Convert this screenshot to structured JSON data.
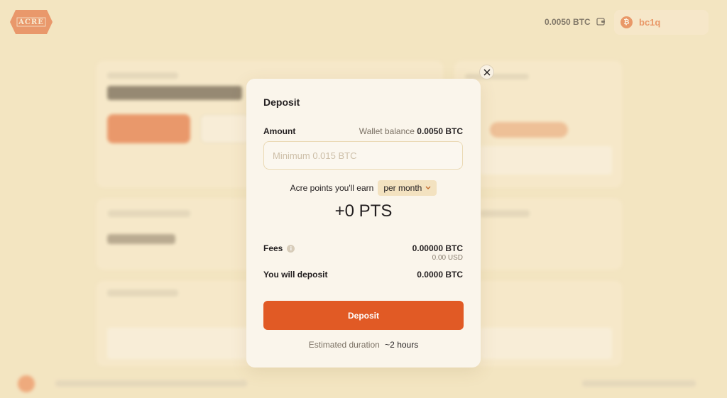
{
  "header": {
    "logo_text": "ACRE",
    "balance": "0.0050 BTC",
    "wallet_icon": "wallet-icon",
    "account_badge": "₿",
    "account_address": "bc1q"
  },
  "modal": {
    "title": "Deposit",
    "amount_label": "Amount",
    "wallet_balance_label": "Wallet balance",
    "wallet_balance_value": "0.0050 BTC",
    "amount_placeholder": "Minimum 0.015 BTC",
    "points_label": "Acre points you'll earn",
    "points_period": "per month",
    "points_value": "+0 PTS",
    "fees_label": "Fees",
    "fees_btc": "0.00000 BTC",
    "fees_usd": "0.00 USD",
    "deposit_total_label": "You will deposit",
    "deposit_total_value": "0.0000 BTC",
    "cta_label": "Deposit",
    "duration_label": "Estimated duration",
    "duration_value": "~2 hours",
    "close_icon": "close-icon"
  },
  "colors": {
    "background": "#f3e5c2",
    "accent": "#e15a25",
    "modal_bg": "#faf5eb"
  }
}
